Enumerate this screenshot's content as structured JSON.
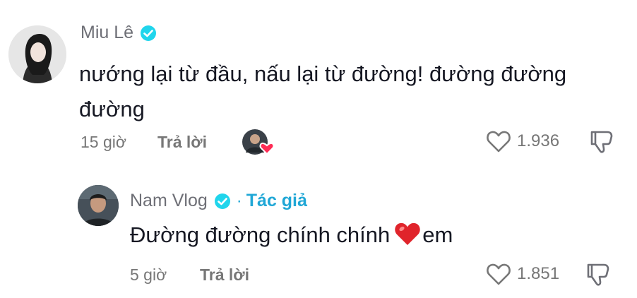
{
  "comments": [
    {
      "author": "Miu Lê",
      "verified": true,
      "text_line1": "nướng lại từ đầu, nấu lại từ đường! đường đường",
      "text_line2": "đường",
      "time": "15 giờ",
      "reply_label": "Trả lời",
      "liked_by_creator": true,
      "likes": "1.936"
    },
    {
      "author": "Nam Vlog",
      "verified": true,
      "separator": "·",
      "author_tag": "Tác giả",
      "text_before_emoji": "Đường đường chính chính",
      "emoji": "red-heart",
      "text_after_emoji": "em",
      "time": "5 giờ",
      "reply_label": "Trả lời",
      "likes": "1.851"
    }
  ],
  "colors": {
    "verified_badge": "#20d5ec",
    "author_tag": "#20a7d6",
    "text": "#161823",
    "muted": "#777777",
    "heart_badge": "#fe2c55"
  },
  "icons": [
    "verified-icon",
    "heart-outline-icon",
    "dislike-icon",
    "heart-emoji"
  ]
}
